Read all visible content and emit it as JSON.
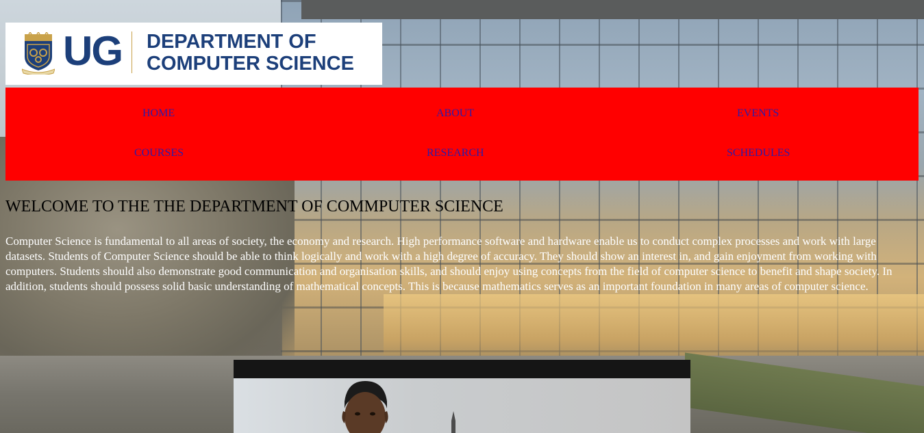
{
  "logo": {
    "short": "UG",
    "title_line1": "DEPARTMENT OF",
    "title_line2": "COMPUTER SCIENCE",
    "crest_icon": "university-crest-icon",
    "brand_blue": "#1c3f7a",
    "brand_gold": "#c9a24a"
  },
  "nav": {
    "background": "#ff0000",
    "link_color": "#2e1ba8",
    "items": [
      {
        "label": "HOME"
      },
      {
        "label": "ABOUT"
      },
      {
        "label": "EVENTS"
      },
      {
        "label": "COURSES"
      },
      {
        "label": "RESEARCH"
      },
      {
        "label": "SCHEDULES"
      }
    ]
  },
  "main": {
    "heading": "WELCOME TO THE THE DEPARTMENT OF COMMPUTER SCIENCE",
    "intro": "Computer Science is fundamental to all areas of society, the economy and research. High performance software and hardware enable us to conduct complex processes and work with large datasets. Students of Computer Science should be able to think logically and work with a high degree of accuracy. They should show an interest in, and gain enjoyment from working with computers. Students should also demonstrate good communication and organisation skills, and should enjoy using concepts from the field of computer science to benefit and shape society. In addition, students should possess solid basic understanding of mathematical concepts. This is because mathematics serves as an important foundation in many areas of computer science."
  },
  "photo": {
    "subject_icon": "student-photo"
  }
}
